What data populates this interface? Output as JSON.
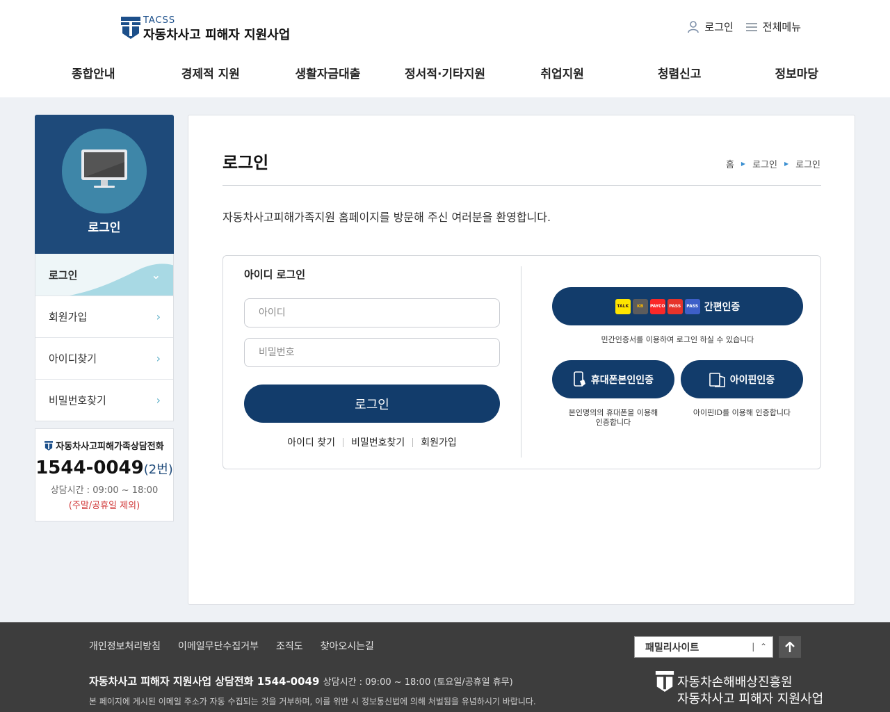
{
  "header": {
    "logo_small": "TACSS",
    "logo_main": "자동차사고 피해자 지원사업",
    "login": "로그인",
    "all_menu": "전체메뉴",
    "nav": [
      "종합안내",
      "경제적 지원",
      "생활자금대출",
      "정서적·기타지원",
      "취업지원",
      "청렴신고",
      "정보마당"
    ]
  },
  "sidebar": {
    "title": "로그인",
    "items": [
      {
        "label": "로그인"
      },
      {
        "label": "회원가입"
      },
      {
        "label": "아이디찾기"
      },
      {
        "label": "비밀번호찾기"
      }
    ],
    "call": {
      "title": "자동차사고피해가족상담전화",
      "number": "1544-0049",
      "ext": "(2번)",
      "hours": "상담시간 : 09:00 ~ 18:00",
      "note": "(주말/공휴일 제외)"
    }
  },
  "content": {
    "title": "로그인",
    "breadcrumb": [
      "홈",
      "로그인",
      "로그인"
    ],
    "welcome": "자동차사고피해가족지원 홈페이지를 방문해 주신 여러분을 환영합니다.",
    "id_login": {
      "heading": "아이디 로그인",
      "id_placeholder": "아이디",
      "pw_placeholder": "비밀번호",
      "login_button": "로그인",
      "links": [
        "아이디 찾기",
        "비밀번호찾기",
        "회원가입"
      ]
    },
    "auth": {
      "simple_label": "간편인증",
      "simple_note": "민간인증서를 이용하여 로그인 하실 수 있습니다",
      "brands": [
        "TALK",
        "KB",
        "PAYCO",
        "PASS",
        "PASS"
      ],
      "phone_label": "휴대폰본인인증",
      "phone_note": "본인명의의 휴대폰을 이용해 인증합니다",
      "ipin_label": "아이핀인증",
      "ipin_note": "아이핀ID를 이용해 인증합니다"
    }
  },
  "footer": {
    "links": [
      "개인정보처리방침",
      "이메일무단수집거부",
      "조직도",
      "찾아오시는길"
    ],
    "family_site": "패밀리사이트",
    "call_line": "자동차사고 피해자 지원사업 상담전화 1544-0049",
    "call_hours": "상담시간 : 09:00 ~ 18:00 (토요일/공휴일 휴무)",
    "notice": "본 페이지에 게시된 이메일 주소가 자동 수집되는 것을 거부하며, 이를 위반 시 정보통신법에 의해 처벌됨을 유념하시기 바랍니다.",
    "logo_line1": "자동차손해배상진흥원",
    "logo_line2": "자동차사고 피해자 지원사업"
  },
  "colors": {
    "primary": "#123c6b",
    "sidebar_head": "#1e4a7a",
    "footer_bg": "#3d3d3d",
    "accent": "#3e86a8"
  }
}
